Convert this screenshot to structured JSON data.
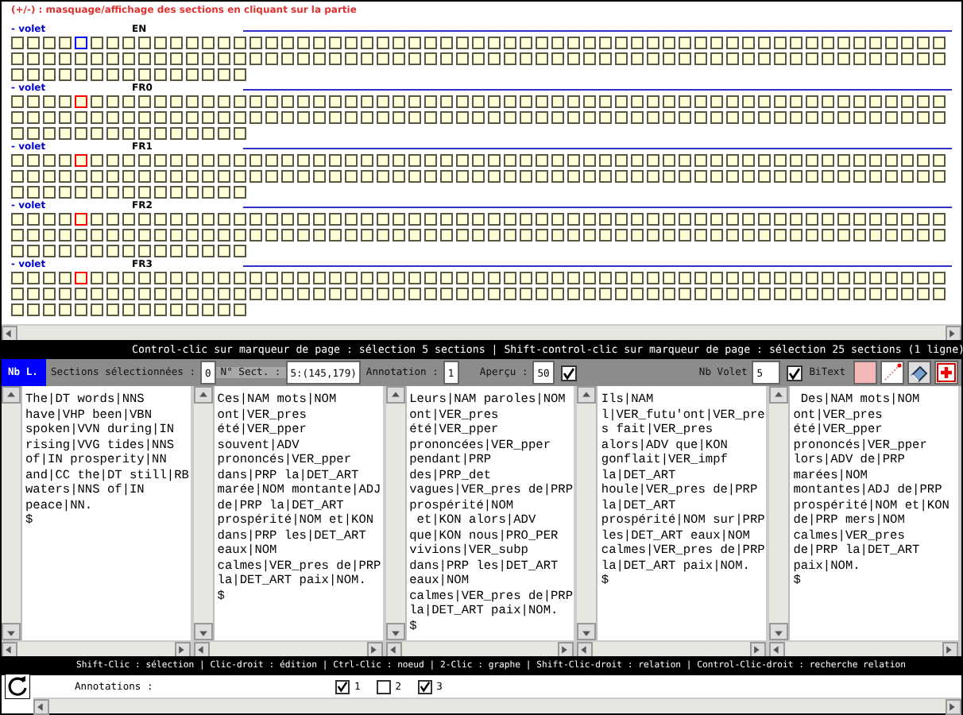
{
  "header": "(+/-) : masquage/affichage des sections en cliquant sur la partie",
  "volets": [
    {
      "toggle": "- volet",
      "language": "EN",
      "color": "#0000ff",
      "sections": [
        {
          "selected": false
        },
        {
          "selected": false
        },
        {
          "selected": false
        },
        {
          "selected": false
        },
        {
          "selected": true
        },
        {
          "selected": false
        },
        {
          "selected": false
        },
        {
          "selected": false
        },
        {
          "selected": false
        },
        {
          "selected": false
        },
        {
          "selected": false
        },
        {
          "selected": false
        },
        {
          "selected": false
        },
        {
          "selected": false
        },
        {
          "selected": false
        },
        {
          "selected": false
        },
        {
          "selected": false
        },
        {
          "selected": false
        },
        {
          "selected": false
        },
        {
          "selected": false
        },
        {
          "selected": false
        },
        {
          "selected": false
        },
        {
          "selected": false
        },
        {
          "selected": false
        },
        {
          "selected": false
        },
        {
          "selected": false
        },
        {
          "selected": false
        },
        {
          "selected": false
        },
        {
          "selected": false
        },
        {
          "selected": false
        },
        {
          "selected": false
        },
        {
          "selected": false
        },
        {
          "selected": false
        },
        {
          "selected": false
        },
        {
          "selected": false
        },
        {
          "selected": false
        },
        {
          "selected": false
        },
        {
          "selected": false
        },
        {
          "selected": false
        },
        {
          "selected": false
        },
        {
          "selected": false
        },
        {
          "selected": false
        },
        {
          "selected": false
        },
        {
          "selected": false
        },
        {
          "selected": false
        },
        {
          "selected": false
        },
        {
          "selected": false
        },
        {
          "selected": false
        },
        {
          "selected": false
        },
        {
          "selected": false
        },
        {
          "selected": false
        },
        {
          "selected": false
        },
        {
          "selected": false
        },
        {
          "selected": false
        },
        {
          "selected": false
        },
        {
          "selected": false
        },
        {
          "selected": false
        },
        {
          "selected": false
        },
        {
          "selected": false
        },
        {
          "selected": false
        },
        {
          "selected": false
        },
        {
          "selected": false
        },
        {
          "selected": false
        },
        {
          "selected": false
        },
        {
          "selected": false
        },
        {
          "selected": false
        },
        {
          "selected": false
        },
        {
          "selected": false
        },
        {
          "selected": false
        },
        {
          "selected": false
        },
        {
          "selected": false
        },
        {
          "selected": false
        },
        {
          "selected": false
        },
        {
          "selected": false
        },
        {
          "selected": false
        },
        {
          "selected": false
        },
        {
          "selected": false
        },
        {
          "selected": false
        },
        {
          "selected": false
        },
        {
          "selected": false
        },
        {
          "selected": false
        },
        {
          "selected": false
        },
        {
          "selected": false
        },
        {
          "selected": false
        },
        {
          "selected": false
        },
        {
          "selected": false
        },
        {
          "selected": false
        },
        {
          "selected": false
        },
        {
          "selected": false
        },
        {
          "selected": false
        },
        {
          "selected": false
        },
        {
          "selected": false
        },
        {
          "selected": false
        },
        {
          "selected": false
        },
        {
          "selected": false
        },
        {
          "selected": false
        },
        {
          "selected": false
        },
        {
          "selected": false
        },
        {
          "selected": false
        },
        {
          "selected": false
        },
        {
          "selected": false
        },
        {
          "selected": false
        },
        {
          "selected": false
        },
        {
          "selected": false
        },
        {
          "selected": false
        },
        {
          "selected": false
        },
        {
          "selected": false
        },
        {
          "selected": false
        },
        {
          "selected": false
        },
        {
          "selected": false
        },
        {
          "selected": false
        },
        {
          "selected": false
        },
        {
          "selected": false
        },
        {
          "selected": false
        },
        {
          "selected": false
        },
        {
          "selected": false
        },
        {
          "selected": false
        },
        {
          "selected": false
        },
        {
          "selected": false
        },
        {
          "selected": false
        },
        {
          "selected": false
        },
        {
          "selected": false
        },
        {
          "selected": false
        },
        {
          "selected": false
        },
        {
          "selected": false
        },
        {
          "selected": false
        },
        {
          "selected": false
        },
        {
          "selected": false
        },
        {
          "selected": false
        },
        {
          "selected": false
        },
        {
          "selected": false
        },
        {
          "selected": false
        },
        {
          "selected": false
        }
      ]
    },
    {
      "toggle": "- volet",
      "language": "FR0",
      "color": "#ff0000",
      "sections": [
        {
          "selected": false
        },
        {
          "selected": false
        },
        {
          "selected": false
        },
        {
          "selected": false
        },
        {
          "selected": true
        },
        {
          "selected": false
        },
        {
          "selected": false
        },
        {
          "selected": false
        },
        {
          "selected": false
        },
        {
          "selected": false
        },
        {
          "selected": false
        },
        {
          "selected": false
        },
        {
          "selected": false
        },
        {
          "selected": false
        },
        {
          "selected": false
        },
        {
          "selected": false
        },
        {
          "selected": false
        },
        {
          "selected": false
        },
        {
          "selected": false
        },
        {
          "selected": false
        },
        {
          "selected": false
        },
        {
          "selected": false
        },
        {
          "selected": false
        },
        {
          "selected": false
        },
        {
          "selected": false
        },
        {
          "selected": false
        },
        {
          "selected": false
        },
        {
          "selected": false
        },
        {
          "selected": false
        },
        {
          "selected": false
        },
        {
          "selected": false
        },
        {
          "selected": false
        },
        {
          "selected": false
        },
        {
          "selected": false
        },
        {
          "selected": false
        },
        {
          "selected": false
        },
        {
          "selected": false
        },
        {
          "selected": false
        },
        {
          "selected": false
        },
        {
          "selected": false
        },
        {
          "selected": false
        },
        {
          "selected": false
        },
        {
          "selected": false
        },
        {
          "selected": false
        },
        {
          "selected": false
        },
        {
          "selected": false
        },
        {
          "selected": false
        },
        {
          "selected": false
        },
        {
          "selected": false
        },
        {
          "selected": false
        },
        {
          "selected": false
        },
        {
          "selected": false
        },
        {
          "selected": false
        },
        {
          "selected": false
        },
        {
          "selected": false
        },
        {
          "selected": false
        },
        {
          "selected": false
        },
        {
          "selected": false
        },
        {
          "selected": false
        },
        {
          "selected": false
        },
        {
          "selected": false
        },
        {
          "selected": false
        },
        {
          "selected": false
        },
        {
          "selected": false
        },
        {
          "selected": false
        },
        {
          "selected": false
        },
        {
          "selected": false
        },
        {
          "selected": false
        },
        {
          "selected": false
        },
        {
          "selected": false
        },
        {
          "selected": false
        },
        {
          "selected": false
        },
        {
          "selected": false
        },
        {
          "selected": false
        },
        {
          "selected": false
        },
        {
          "selected": false
        },
        {
          "selected": false
        },
        {
          "selected": false
        },
        {
          "selected": false
        },
        {
          "selected": false
        },
        {
          "selected": false
        },
        {
          "selected": false
        },
        {
          "selected": false
        },
        {
          "selected": false
        },
        {
          "selected": false
        },
        {
          "selected": false
        },
        {
          "selected": false
        },
        {
          "selected": false
        },
        {
          "selected": false
        },
        {
          "selected": false
        },
        {
          "selected": false
        },
        {
          "selected": false
        },
        {
          "selected": false
        },
        {
          "selected": false
        },
        {
          "selected": false
        },
        {
          "selected": false
        },
        {
          "selected": false
        },
        {
          "selected": false
        },
        {
          "selected": false
        },
        {
          "selected": false
        },
        {
          "selected": false
        },
        {
          "selected": false
        },
        {
          "selected": false
        },
        {
          "selected": false
        },
        {
          "selected": false
        },
        {
          "selected": false
        },
        {
          "selected": false
        },
        {
          "selected": false
        },
        {
          "selected": false
        },
        {
          "selected": false
        },
        {
          "selected": false
        },
        {
          "selected": false
        },
        {
          "selected": false
        },
        {
          "selected": false
        },
        {
          "selected": false
        },
        {
          "selected": false
        },
        {
          "selected": false
        },
        {
          "selected": false
        },
        {
          "selected": false
        },
        {
          "selected": false
        },
        {
          "selected": false
        },
        {
          "selected": false
        },
        {
          "selected": false
        },
        {
          "selected": false
        },
        {
          "selected": false
        },
        {
          "selected": false
        },
        {
          "selected": false
        },
        {
          "selected": false
        },
        {
          "selected": false
        },
        {
          "selected": false
        },
        {
          "selected": false
        },
        {
          "selected": false
        },
        {
          "selected": false
        }
      ]
    },
    {
      "toggle": "- volet",
      "language": "FR1",
      "color": "#ff0000",
      "sections": [
        {
          "selected": false
        },
        {
          "selected": false
        },
        {
          "selected": false
        },
        {
          "selected": false
        },
        {
          "selected": true
        },
        {
          "selected": false
        },
        {
          "selected": false
        },
        {
          "selected": false
        },
        {
          "selected": false
        },
        {
          "selected": false
        },
        {
          "selected": false
        },
        {
          "selected": false
        },
        {
          "selected": false
        },
        {
          "selected": false
        },
        {
          "selected": false
        },
        {
          "selected": false
        },
        {
          "selected": false
        },
        {
          "selected": false
        },
        {
          "selected": false
        },
        {
          "selected": false
        },
        {
          "selected": false
        },
        {
          "selected": false
        },
        {
          "selected": false
        },
        {
          "selected": false
        },
        {
          "selected": false
        },
        {
          "selected": false
        },
        {
          "selected": false
        },
        {
          "selected": false
        },
        {
          "selected": false
        },
        {
          "selected": false
        },
        {
          "selected": false
        },
        {
          "selected": false
        },
        {
          "selected": false
        },
        {
          "selected": false
        },
        {
          "selected": false
        },
        {
          "selected": false
        },
        {
          "selected": false
        },
        {
          "selected": false
        },
        {
          "selected": false
        },
        {
          "selected": false
        },
        {
          "selected": false
        },
        {
          "selected": false
        },
        {
          "selected": false
        },
        {
          "selected": false
        },
        {
          "selected": false
        },
        {
          "selected": false
        },
        {
          "selected": false
        },
        {
          "selected": false
        },
        {
          "selected": false
        },
        {
          "selected": false
        },
        {
          "selected": false
        },
        {
          "selected": false
        },
        {
          "selected": false
        },
        {
          "selected": false
        },
        {
          "selected": false
        },
        {
          "selected": false
        },
        {
          "selected": false
        },
        {
          "selected": false
        },
        {
          "selected": false
        },
        {
          "selected": false
        },
        {
          "selected": false
        },
        {
          "selected": false
        },
        {
          "selected": false
        },
        {
          "selected": false
        },
        {
          "selected": false
        },
        {
          "selected": false
        },
        {
          "selected": false
        },
        {
          "selected": false
        },
        {
          "selected": false
        },
        {
          "selected": false
        },
        {
          "selected": false
        },
        {
          "selected": false
        },
        {
          "selected": false
        },
        {
          "selected": false
        },
        {
          "selected": false
        },
        {
          "selected": false
        },
        {
          "selected": false
        },
        {
          "selected": false
        },
        {
          "selected": false
        },
        {
          "selected": false
        },
        {
          "selected": false
        },
        {
          "selected": false
        },
        {
          "selected": false
        },
        {
          "selected": false
        },
        {
          "selected": false
        },
        {
          "selected": false
        },
        {
          "selected": false
        },
        {
          "selected": false
        },
        {
          "selected": false
        },
        {
          "selected": false
        },
        {
          "selected": false
        },
        {
          "selected": false
        },
        {
          "selected": false
        },
        {
          "selected": false
        },
        {
          "selected": false
        },
        {
          "selected": false
        },
        {
          "selected": false
        },
        {
          "selected": false
        },
        {
          "selected": false
        },
        {
          "selected": false
        },
        {
          "selected": false
        },
        {
          "selected": false
        },
        {
          "selected": false
        },
        {
          "selected": false
        },
        {
          "selected": false
        },
        {
          "selected": false
        },
        {
          "selected": false
        },
        {
          "selected": false
        },
        {
          "selected": false
        },
        {
          "selected": false
        },
        {
          "selected": false
        },
        {
          "selected": false
        },
        {
          "selected": false
        },
        {
          "selected": false
        },
        {
          "selected": false
        },
        {
          "selected": false
        },
        {
          "selected": false
        },
        {
          "selected": false
        },
        {
          "selected": false
        },
        {
          "selected": false
        },
        {
          "selected": false
        },
        {
          "selected": false
        },
        {
          "selected": false
        },
        {
          "selected": false
        },
        {
          "selected": false
        },
        {
          "selected": false
        },
        {
          "selected": false
        },
        {
          "selected": false
        },
        {
          "selected": false
        },
        {
          "selected": false
        },
        {
          "selected": false
        },
        {
          "selected": false
        },
        {
          "selected": false
        }
      ]
    },
    {
      "toggle": "- volet",
      "language": "FR2",
      "color": "#ff0000",
      "sections": [
        {
          "selected": false
        },
        {
          "selected": false
        },
        {
          "selected": false
        },
        {
          "selected": false
        },
        {
          "selected": true
        },
        {
          "selected": false
        },
        {
          "selected": false
        },
        {
          "selected": false
        },
        {
          "selected": false
        },
        {
          "selected": false
        },
        {
          "selected": false
        },
        {
          "selected": false
        },
        {
          "selected": false
        },
        {
          "selected": false
        },
        {
          "selected": false
        },
        {
          "selected": false
        },
        {
          "selected": false
        },
        {
          "selected": false
        },
        {
          "selected": false
        },
        {
          "selected": false
        },
        {
          "selected": false
        },
        {
          "selected": false
        },
        {
          "selected": false
        },
        {
          "selected": false
        },
        {
          "selected": false
        },
        {
          "selected": false
        },
        {
          "selected": false
        },
        {
          "selected": false
        },
        {
          "selected": false
        },
        {
          "selected": false
        },
        {
          "selected": false
        },
        {
          "selected": false
        },
        {
          "selected": false
        },
        {
          "selected": false
        },
        {
          "selected": false
        },
        {
          "selected": false
        },
        {
          "selected": false
        },
        {
          "selected": false
        },
        {
          "selected": false
        },
        {
          "selected": false
        },
        {
          "selected": false
        },
        {
          "selected": false
        },
        {
          "selected": false
        },
        {
          "selected": false
        },
        {
          "selected": false
        },
        {
          "selected": false
        },
        {
          "selected": false
        },
        {
          "selected": false
        },
        {
          "selected": false
        },
        {
          "selected": false
        },
        {
          "selected": false
        },
        {
          "selected": false
        },
        {
          "selected": false
        },
        {
          "selected": false
        },
        {
          "selected": false
        },
        {
          "selected": false
        },
        {
          "selected": false
        },
        {
          "selected": false
        },
        {
          "selected": false
        },
        {
          "selected": false
        },
        {
          "selected": false
        },
        {
          "selected": false
        },
        {
          "selected": false
        },
        {
          "selected": false
        },
        {
          "selected": false
        },
        {
          "selected": false
        },
        {
          "selected": false
        },
        {
          "selected": false
        },
        {
          "selected": false
        },
        {
          "selected": false
        },
        {
          "selected": false
        },
        {
          "selected": false
        },
        {
          "selected": false
        },
        {
          "selected": false
        },
        {
          "selected": false
        },
        {
          "selected": false
        },
        {
          "selected": false
        },
        {
          "selected": false
        },
        {
          "selected": false
        },
        {
          "selected": false
        },
        {
          "selected": false
        },
        {
          "selected": false
        },
        {
          "selected": false
        },
        {
          "selected": false
        },
        {
          "selected": false
        },
        {
          "selected": false
        },
        {
          "selected": false
        },
        {
          "selected": false
        },
        {
          "selected": false
        },
        {
          "selected": false
        },
        {
          "selected": false
        },
        {
          "selected": false
        },
        {
          "selected": false
        },
        {
          "selected": false
        },
        {
          "selected": false
        },
        {
          "selected": false
        },
        {
          "selected": false
        },
        {
          "selected": false
        },
        {
          "selected": false
        },
        {
          "selected": false
        },
        {
          "selected": false
        },
        {
          "selected": false
        },
        {
          "selected": false
        },
        {
          "selected": false
        },
        {
          "selected": false
        },
        {
          "selected": false
        },
        {
          "selected": false
        },
        {
          "selected": false
        },
        {
          "selected": false
        },
        {
          "selected": false
        },
        {
          "selected": false
        },
        {
          "selected": false
        },
        {
          "selected": false
        },
        {
          "selected": false
        },
        {
          "selected": false
        },
        {
          "selected": false
        },
        {
          "selected": false
        },
        {
          "selected": false
        },
        {
          "selected": false
        },
        {
          "selected": false
        },
        {
          "selected": false
        },
        {
          "selected": false
        },
        {
          "selected": false
        },
        {
          "selected": false
        },
        {
          "selected": false
        },
        {
          "selected": false
        },
        {
          "selected": false
        },
        {
          "selected": false
        },
        {
          "selected": false
        },
        {
          "selected": false
        },
        {
          "selected": false
        },
        {
          "selected": false
        },
        {
          "selected": false
        }
      ]
    },
    {
      "toggle": "- volet",
      "language": "FR3",
      "color": "#ff0000",
      "sections": [
        {
          "selected": false
        },
        {
          "selected": false
        },
        {
          "selected": false
        },
        {
          "selected": false
        },
        {
          "selected": true
        },
        {
          "selected": false
        },
        {
          "selected": false
        },
        {
          "selected": false
        },
        {
          "selected": false
        },
        {
          "selected": false
        },
        {
          "selected": false
        },
        {
          "selected": false
        },
        {
          "selected": false
        },
        {
          "selected": false
        },
        {
          "selected": false
        },
        {
          "selected": false
        },
        {
          "selected": false
        },
        {
          "selected": false
        },
        {
          "selected": false
        },
        {
          "selected": false
        },
        {
          "selected": false
        },
        {
          "selected": false
        },
        {
          "selected": false
        },
        {
          "selected": false
        },
        {
          "selected": false
        },
        {
          "selected": false
        },
        {
          "selected": false
        },
        {
          "selected": false
        },
        {
          "selected": false
        },
        {
          "selected": false
        },
        {
          "selected": false
        },
        {
          "selected": false
        },
        {
          "selected": false
        },
        {
          "selected": false
        },
        {
          "selected": false
        },
        {
          "selected": false
        },
        {
          "selected": false
        },
        {
          "selected": false
        },
        {
          "selected": false
        },
        {
          "selected": false
        },
        {
          "selected": false
        },
        {
          "selected": false
        },
        {
          "selected": false
        },
        {
          "selected": false
        },
        {
          "selected": false
        },
        {
          "selected": false
        },
        {
          "selected": false
        },
        {
          "selected": false
        },
        {
          "selected": false
        },
        {
          "selected": false
        },
        {
          "selected": false
        },
        {
          "selected": false
        },
        {
          "selected": false
        },
        {
          "selected": false
        },
        {
          "selected": false
        },
        {
          "selected": false
        },
        {
          "selected": false
        },
        {
          "selected": false
        },
        {
          "selected": false
        },
        {
          "selected": false
        },
        {
          "selected": false
        },
        {
          "selected": false
        },
        {
          "selected": false
        },
        {
          "selected": false
        },
        {
          "selected": false
        },
        {
          "selected": false
        },
        {
          "selected": false
        },
        {
          "selected": false
        },
        {
          "selected": false
        },
        {
          "selected": false
        },
        {
          "selected": false
        },
        {
          "selected": false
        },
        {
          "selected": false
        },
        {
          "selected": false
        },
        {
          "selected": false
        },
        {
          "selected": false
        },
        {
          "selected": false
        },
        {
          "selected": false
        },
        {
          "selected": false
        },
        {
          "selected": false
        },
        {
          "selected": false
        },
        {
          "selected": false
        },
        {
          "selected": false
        },
        {
          "selected": false
        },
        {
          "selected": false
        },
        {
          "selected": false
        },
        {
          "selected": false
        },
        {
          "selected": false
        },
        {
          "selected": false
        },
        {
          "selected": false
        },
        {
          "selected": false
        },
        {
          "selected": false
        },
        {
          "selected": false
        },
        {
          "selected": false
        },
        {
          "selected": false
        },
        {
          "selected": false
        },
        {
          "selected": false
        },
        {
          "selected": false
        },
        {
          "selected": false
        },
        {
          "selected": false
        },
        {
          "selected": false
        },
        {
          "selected": false
        },
        {
          "selected": false
        },
        {
          "selected": false
        },
        {
          "selected": false
        },
        {
          "selected": false
        },
        {
          "selected": false
        },
        {
          "selected": false
        },
        {
          "selected": false
        },
        {
          "selected": false
        },
        {
          "selected": false
        },
        {
          "selected": false
        },
        {
          "selected": false
        },
        {
          "selected": false
        },
        {
          "selected": false
        },
        {
          "selected": false
        },
        {
          "selected": false
        },
        {
          "selected": false
        },
        {
          "selected": false
        },
        {
          "selected": false
        },
        {
          "selected": false
        },
        {
          "selected": false
        },
        {
          "selected": false
        },
        {
          "selected": false
        },
        {
          "selected": false
        },
        {
          "selected": false
        },
        {
          "selected": false
        },
        {
          "selected": false
        },
        {
          "selected": false
        },
        {
          "selected": false
        },
        {
          "selected": false
        },
        {
          "selected": false
        },
        {
          "selected": false
        }
      ]
    }
  ],
  "hint_top": "Control-clic sur marqueur de page : sélection 5 sections | Shift-control-clic sur marqueur de page : sélection 25 sections (1 ligne)",
  "toolbar": {
    "nb_lines": "Nb L.",
    "sections_label": "Sections sélectionnées :",
    "sections_value": "0",
    "section_label": "N° Sect. :",
    "section_value": "5:(145,179)",
    "annotation_label": "Annotation :",
    "annotation_value": "1",
    "preview_label": "Aperçu :",
    "preview_value": "50",
    "preview_checked": true,
    "volets_label": "Nb Volet",
    "volets_value": "5",
    "bitext": {
      "label": "BiText",
      "checked": true
    }
  },
  "panes": [
    {
      "text": "The|DT words|NNS\nhave|VHP been|VBN\nspoken|VVN during|IN\nrising|VVG tides|NNS\nof|IN prosperity|NN\nand|CC the|DT still|RB\nwaters|NNS of|IN\npeace|NN.\n$"
    },
    {
      "text": "Ces|NAM mots|NOM\nont|VER_pres\nété|VER_pper\nsouvent|ADV\nprononcés|VER_pper\ndans|PRP la|DET_ART\nmarée|NOM montante|ADJ\nde|PRP la|DET_ART\nprospérité|NOM et|KON\ndans|PRP les|DET_ART\neaux|NOM\ncalmes|VER_pres de|PRP\nla|DET_ART paix|NOM.\n$"
    },
    {
      "text": "Leurs|NAM paroles|NOM\nont|VER_pres\nété|VER_pper\nprononcées|VER_pper\npendant|PRP\ndes|PRP_det\nvagues|VER_pres de|PRP\nprospérité|NOM\n et|KON alors|ADV\nque|KON nous|PRO_PER\nvivions|VER_subp\ndans|PRP les|DET_ART\neaux|NOM\ncalmes|VER_pres de|PRP\nla|DET_ART paix|NOM.\n$"
    },
    {
      "text": "Ils|NAM\nl|VER_futu'ont|VER_pre\ns fait|VER_pres\nalors|ADV que|KON\ngonflait|VER_impf\nla|DET_ART\nhoule|VER_pres de|PRP\nla|DET_ART\nprospérité|NOM sur|PRP\nles|DET_ART eaux|NOM\ncalmes|VER_pres de|PRP\nla|DET_ART paix|NOM.\n$"
    },
    {
      "text": " Des|NAM mots|NOM\nont|VER_pres\nété|VER_pper\nprononcés|VER_pper\nlors|ADV de|PRP\nmarées|NOM\nmontantes|ADJ de|PRP\nprospérité|NOM et|KON\nde|PRP mers|NOM\ncalmes|VER_pres\nde|PRP la|DET_ART\npaix|NOM.\n$"
    }
  ],
  "hint_bottom": "Shift-Clic : sélection | Clic-droit : édition | Ctrl-Clic : noeud | 2-Clic : graphe | Shift-Clic-droit : relation | Control-Clic-droit : recherche relation",
  "annotations": {
    "label": "Annotations :",
    "items": [
      {
        "label": "1",
        "checked": true
      },
      {
        "label": "2",
        "checked": false
      },
      {
        "label": "3",
        "checked": true
      }
    ]
  }
}
